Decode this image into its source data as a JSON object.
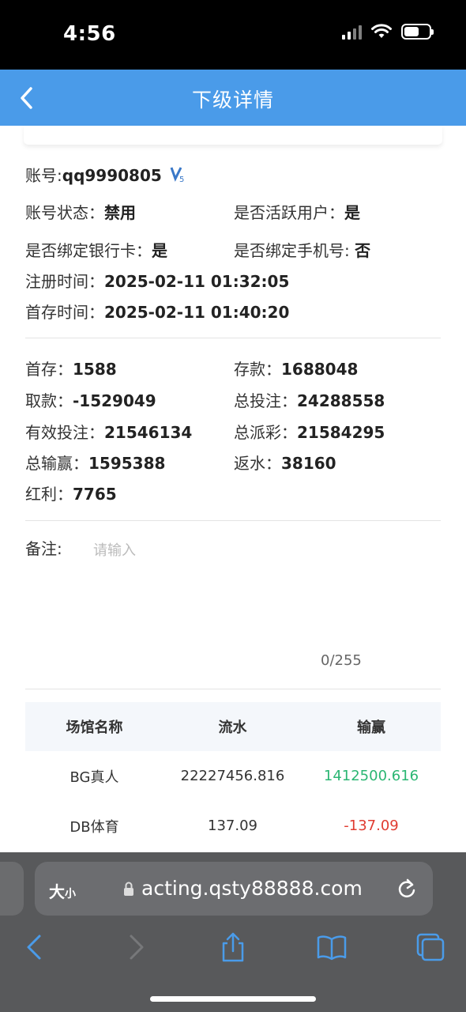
{
  "status_bar": {
    "time": "4:56"
  },
  "nav": {
    "title": "下级详情"
  },
  "account": {
    "label": "账号:",
    "value": "qq9990805",
    "vip_badge": "V5",
    "status_label": "账号状态：",
    "status_value": "禁用",
    "active_label": "是否活跃用户：",
    "active_value": "是",
    "bank_label": "是否绑定银行卡：",
    "bank_value": "是",
    "phone_label": "是否绑定手机号:",
    "phone_value": "否",
    "register_label": "注册时间：",
    "register_value": "2025-02-11 01:32:05",
    "first_deposit_time_label": "首存时间：",
    "first_deposit_time_value": "2025-02-11 01:40:20"
  },
  "stats": {
    "first_deposit_label": "首存：",
    "first_deposit": "1588",
    "deposit_label": "存款：",
    "deposit": "1688048",
    "withdraw_label": "取款：",
    "withdraw": "-1529049",
    "total_bet_label": "总投注：",
    "total_bet": "24288558",
    "valid_bet_label": "有效投注：",
    "valid_bet": "21546134",
    "total_payout_label": "总派彩：",
    "total_payout": "21584295",
    "total_winloss_label": "总输赢：",
    "total_winloss": "1595388",
    "rebate_label": "返水：",
    "rebate": "38160",
    "bonus_label": "红利：",
    "bonus": "7765"
  },
  "remark": {
    "label": "备注:",
    "placeholder": "请输入",
    "count": "0/255"
  },
  "table": {
    "headers": [
      "场馆名称",
      "流水",
      "输赢"
    ],
    "rows": [
      {
        "venue": "BG真人",
        "turnover": "22227456.816",
        "winloss": "1412500.616"
      },
      {
        "venue": "DB体育",
        "turnover": "137.09",
        "winloss": "-137.09"
      }
    ]
  },
  "browser": {
    "text_size": "大",
    "text_size_small": "小",
    "url": "acting.qsty88888.com"
  },
  "colors": {
    "nav": "#4a9be9",
    "positive": "#2bb673",
    "negative": "#e03c31"
  }
}
